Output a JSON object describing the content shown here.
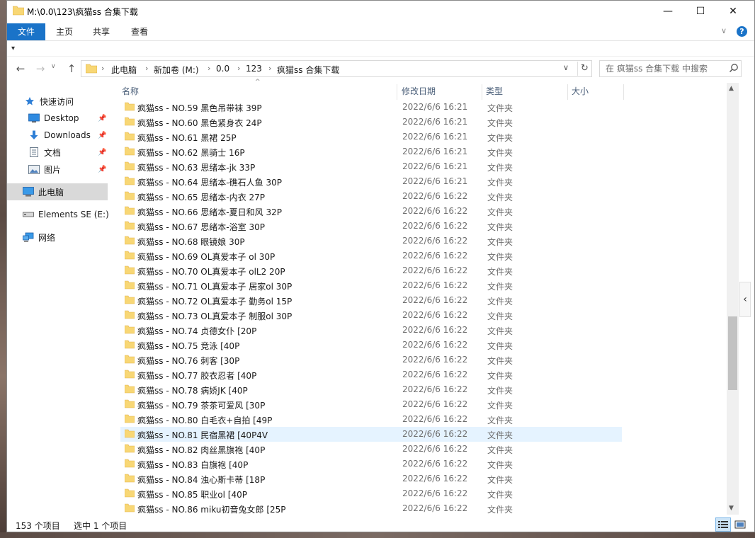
{
  "window": {
    "title": "M:\\0.0\\123\\疯猫ss 合集下载",
    "min_glyph": "—",
    "max_glyph": "☐",
    "close_glyph": "✕"
  },
  "ribbon": {
    "tabs": [
      "文件",
      "主页",
      "共享",
      "查看"
    ],
    "expand_glyph": "∨",
    "help_glyph": "?"
  },
  "quick_access_toolbar": {
    "glyph": "▾"
  },
  "navigation": {
    "back_glyph": "←",
    "forward_glyph": "→",
    "dropdown_glyph": "∨",
    "up_glyph": "↑"
  },
  "address": {
    "crumbs": [
      "此电脑",
      "新加卷 (M:)",
      "0.0",
      "123",
      "疯猫ss 合集下载"
    ],
    "separator": "›",
    "dropdown_glyph": "∨",
    "refresh_glyph": "↻"
  },
  "search": {
    "placeholder": "在 疯猫ss 合集下载 中搜索"
  },
  "sidebar": {
    "quick_access": "快速访问",
    "desktop": "Desktop",
    "downloads": "Downloads",
    "documents": "文档",
    "pictures": "图片",
    "this_pc": "此电脑",
    "elements": "Elements SE (E:)",
    "network": "网络",
    "pin_glyph": "📌"
  },
  "columns": {
    "name": "名称",
    "date": "修改日期",
    "type": "类型",
    "size": "大小",
    "sort_glyph": "^"
  },
  "files": [
    {
      "name": "疯猫ss - NO.59 黑色吊带袜 39P",
      "date": "2022/6/6 16:21",
      "type": "文件夹"
    },
    {
      "name": "疯猫ss - NO.60 黑色紧身衣 24P",
      "date": "2022/6/6 16:21",
      "type": "文件夹"
    },
    {
      "name": "疯猫ss - NO.61 黑裙 25P",
      "date": "2022/6/6 16:21",
      "type": "文件夹"
    },
    {
      "name": "疯猫ss - NO.62 黑骑士 16P",
      "date": "2022/6/6 16:21",
      "type": "文件夹"
    },
    {
      "name": "疯猫ss - NO.63 思绪本-jk 33P",
      "date": "2022/6/6 16:21",
      "type": "文件夹"
    },
    {
      "name": "疯猫ss - NO.64 思绪本-礁石人鱼 30P",
      "date": "2022/6/6 16:21",
      "type": "文件夹"
    },
    {
      "name": "疯猫ss - NO.65 思绪本-内衣 27P",
      "date": "2022/6/6 16:22",
      "type": "文件夹"
    },
    {
      "name": "疯猫ss - NO.66 思绪本-夏日和风 32P",
      "date": "2022/6/6 16:22",
      "type": "文件夹"
    },
    {
      "name": "疯猫ss - NO.67 思绪本-浴室 30P",
      "date": "2022/6/6 16:22",
      "type": "文件夹"
    },
    {
      "name": "疯猫ss - NO.68 眼镜娘 30P",
      "date": "2022/6/6 16:22",
      "type": "文件夹"
    },
    {
      "name": "疯猫ss - NO.69 OL真爱本子 ol 30P",
      "date": "2022/6/6 16:22",
      "type": "文件夹"
    },
    {
      "name": "疯猫ss - NO.70 OL真爱本子 olL2 20P",
      "date": "2022/6/6 16:22",
      "type": "文件夹"
    },
    {
      "name": "疯猫ss - NO.71 OL真爱本子 居家ol 30P",
      "date": "2022/6/6 16:22",
      "type": "文件夹"
    },
    {
      "name": "疯猫ss - NO.72 OL真爱本子 勤务ol 15P",
      "date": "2022/6/6 16:22",
      "type": "文件夹"
    },
    {
      "name": "疯猫ss - NO.73 OL真爱本子 制服ol 30P",
      "date": "2022/6/6 16:22",
      "type": "文件夹"
    },
    {
      "name": "疯猫ss - NO.74 贞德女仆 [20P",
      "date": "2022/6/6 16:22",
      "type": "文件夹"
    },
    {
      "name": "疯猫ss - NO.75 竞泳 [40P",
      "date": "2022/6/6 16:22",
      "type": "文件夹"
    },
    {
      "name": "疯猫ss - NO.76 刺客 [30P",
      "date": "2022/6/6 16:22",
      "type": "文件夹"
    },
    {
      "name": "疯猫ss - NO.77 胶衣忍者 [40P",
      "date": "2022/6/6 16:22",
      "type": "文件夹"
    },
    {
      "name": "疯猫ss - NO.78 病娇JK [40P",
      "date": "2022/6/6 16:22",
      "type": "文件夹"
    },
    {
      "name": "疯猫ss - NO.79 茶茶可爱风 [30P",
      "date": "2022/6/6 16:22",
      "type": "文件夹"
    },
    {
      "name": "疯猫ss - NO.80 白毛衣+自拍 [49P",
      "date": "2022/6/6 16:22",
      "type": "文件夹"
    },
    {
      "name": "疯猫ss - NO.81 民宿黑裙 [40P4V",
      "date": "2022/6/6 16:22",
      "type": "文件夹"
    },
    {
      "name": "疯猫ss - NO.82 肉丝黑旗袍 [40P",
      "date": "2022/6/6 16:22",
      "type": "文件夹"
    },
    {
      "name": "疯猫ss - NO.83 白旗袍 [40P",
      "date": "2022/6/6 16:22",
      "type": "文件夹"
    },
    {
      "name": "疯猫ss - NO.84 浊心斯卡蒂 [18P",
      "date": "2022/6/6 16:22",
      "type": "文件夹"
    },
    {
      "name": "疯猫ss - NO.85 职业ol [40P",
      "date": "2022/6/6 16:22",
      "type": "文件夹"
    },
    {
      "name": "疯猫ss - NO.86 miku初音兔女郎 [25P",
      "date": "2022/6/6 16:22",
      "type": "文件夹"
    }
  ],
  "selected_index": 22,
  "scrollbar": {
    "up_glyph": "▲",
    "down_glyph": "▼"
  },
  "side_tab_glyph": "‹",
  "status": {
    "count": "153 个项目",
    "selected": "选中 1 个项目"
  },
  "colors": {
    "accent": "#1a73c8",
    "folder": "#f8d775",
    "selected_row": "#e5f3ff",
    "header_text": "#4c607a"
  }
}
